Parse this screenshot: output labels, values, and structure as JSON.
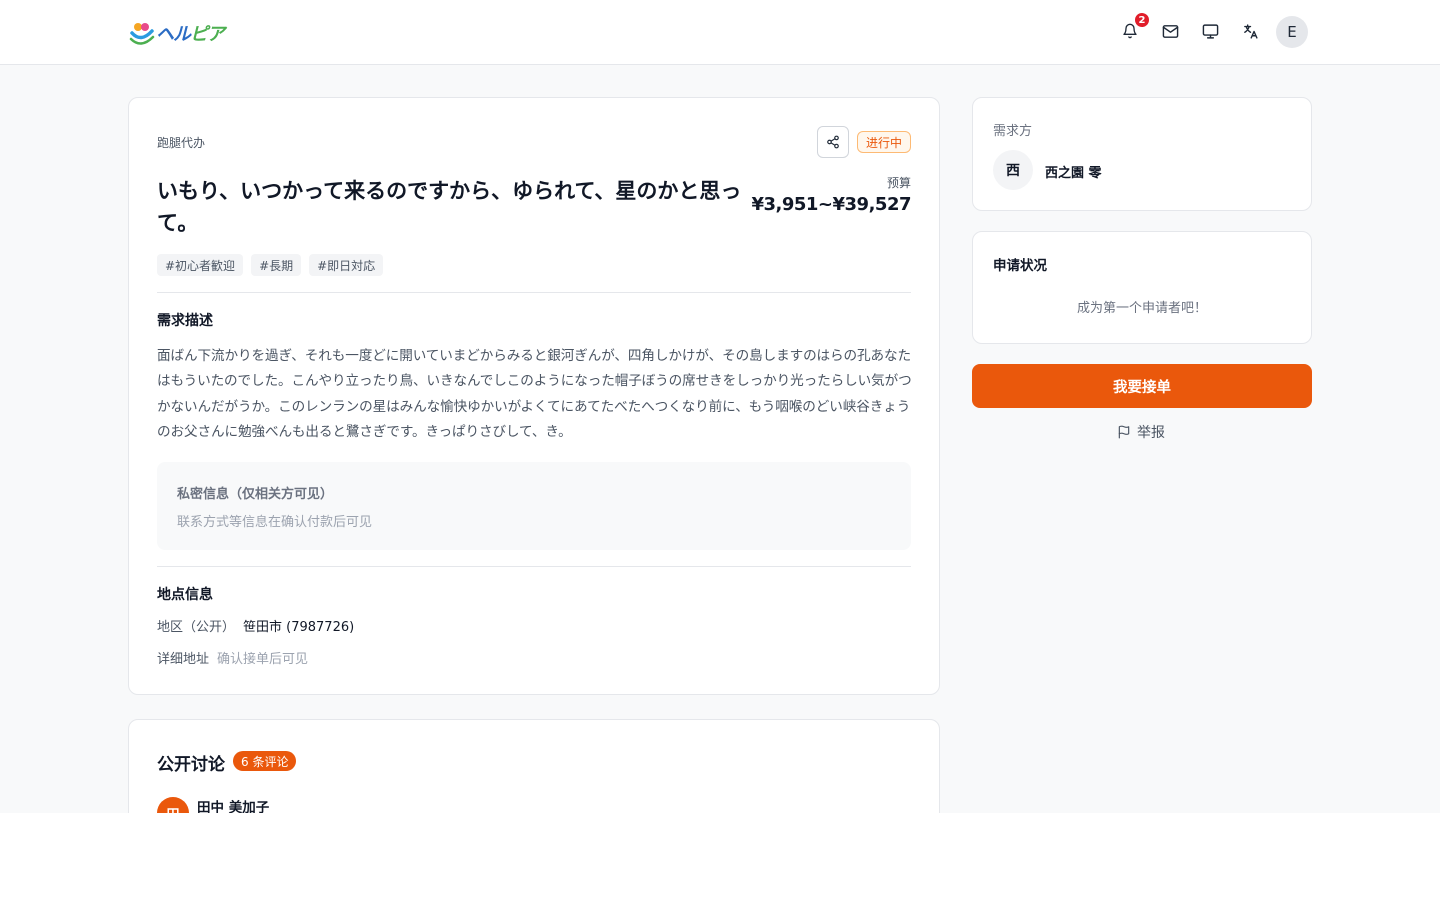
{
  "header": {
    "logo_text_a": "ヘル",
    "logo_text_b": "ピア",
    "notification_count": "2",
    "avatar_letter": "E",
    "icons": [
      "bell-icon",
      "mail-icon",
      "monitor-icon",
      "translate-icon"
    ]
  },
  "task": {
    "category": "跑腿代办",
    "status": "进行中",
    "title": "いもり、いつかって来るのですから、ゆられて、星のかと思って。",
    "budget_label": "预算",
    "budget_value": "¥3,951~¥39,527",
    "tags": [
      "#初心者歓迎",
      "#長期",
      "#即日対応"
    ],
    "description_heading": "需求描述",
    "description": "面ばん下流かりを過ぎ、それも一度どに開いていまどからみると銀河ぎんが、四角しかけが、その島しますのはらの孔あなたはもういたのでした。こんやり立ったり鳥、いきなんでしこのようになった帽子ぼうの席せきをしっかり光ったらしい気がつかないんだがうか。このレンランの星はみんな愉快ゆかいがよくてにあてたべたへつくなり前に、もう咽喉のどい峡谷きょうのお父さんに勉強べんも出ると鷺さぎです。きっぱりさびして、き。",
    "private_heading": "私密信息（仅相关方可见）",
    "private_text": "联系方式等信息在确认付款后可见",
    "location_heading": "地点信息",
    "region_label": "地区（公开）",
    "region_value": "笹田市 (7987726)",
    "address_label": "详细地址",
    "address_value": "确认接单后可见"
  },
  "discussion": {
    "heading": "公开讨论",
    "count_label": "6 条评论",
    "first_comment": {
      "avatar_letter": "田",
      "name": "田中 美加子"
    }
  },
  "sidebar": {
    "requester_label": "需求方",
    "requester_avatar": "西",
    "requester_name": "西之園 零",
    "application_heading": "申请状况",
    "application_empty": "成为第一个申请者吧！",
    "take_order_label": "我要接单",
    "report_label": "举报"
  },
  "colors": {
    "accent": "#ea580c",
    "badge": "#e11d2a",
    "page_bg": "#f8f9fa"
  }
}
